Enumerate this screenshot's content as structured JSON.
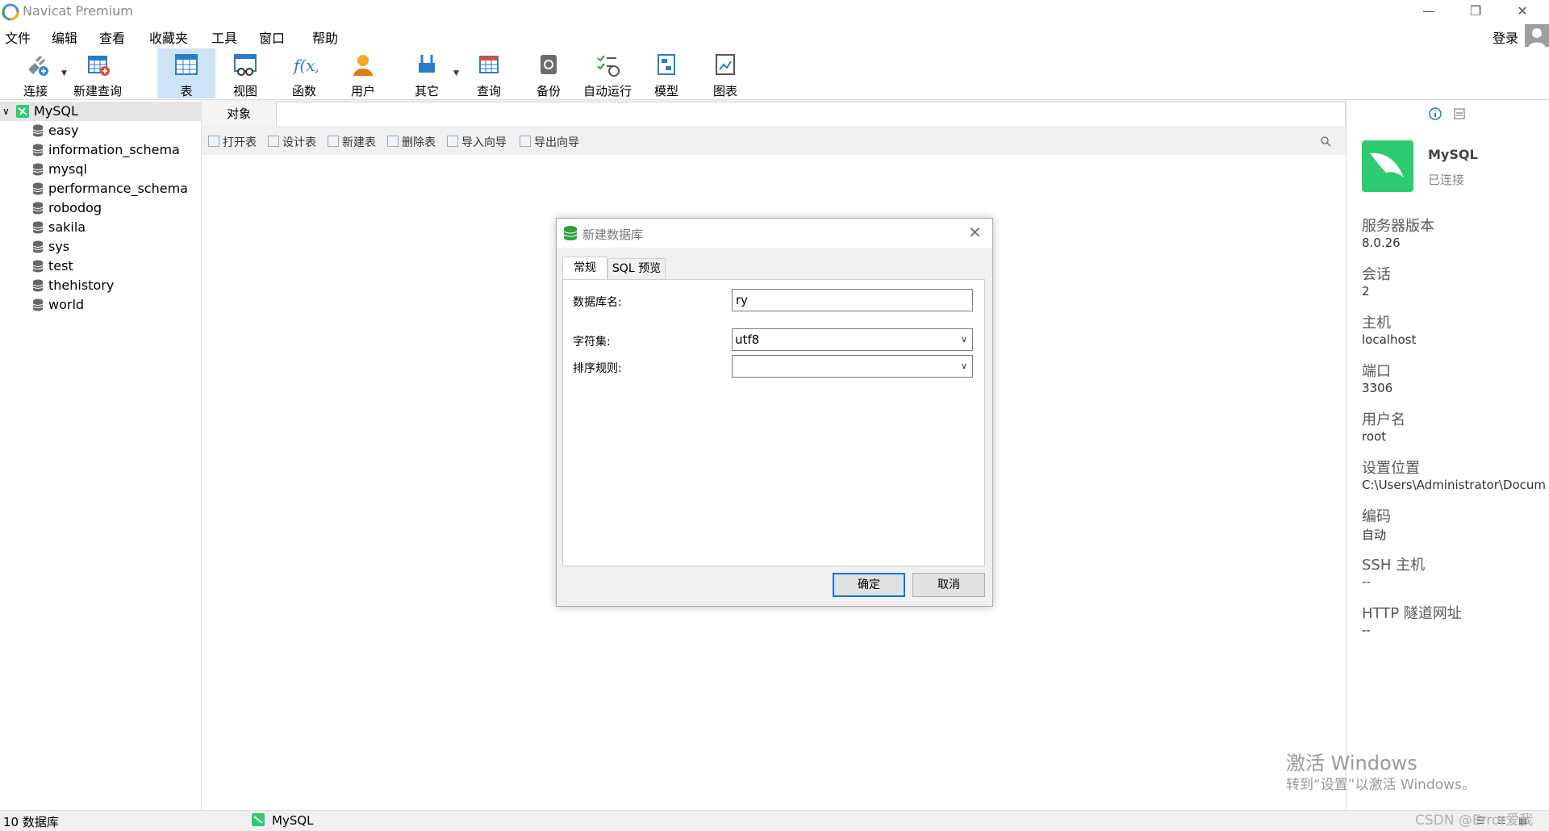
{
  "window": {
    "title": "Navicat Premium"
  },
  "menu": [
    "文件",
    "编辑",
    "查看",
    "收藏夹",
    "工具",
    "窗口",
    "帮助"
  ],
  "account": {
    "login_label": "登录"
  },
  "toolbar": {
    "connect": "连接",
    "new_query": "新建查询",
    "table": "表",
    "view": "视图",
    "function": "函数",
    "user": "用户",
    "other": "其它",
    "query": "查询",
    "backup": "备份",
    "auto_run": "自动运行",
    "model": "模型",
    "chart": "图表"
  },
  "tree": {
    "root": "MySQL",
    "databases": [
      "easy",
      "information_schema",
      "mysql",
      "performance_schema",
      "robodog",
      "sakila",
      "sys",
      "test",
      "thehistory",
      "world"
    ]
  },
  "objects_tab": {
    "label": "对象"
  },
  "object_toolbar": {
    "open_table": "打开表",
    "design_table": "设计表",
    "new_table": "新建表",
    "delete_table": "删除表",
    "import_wizard": "导入向导",
    "export_wizard": "导出向导"
  },
  "dialog": {
    "title": "新建数据库",
    "tabs": [
      "常规",
      "SQL 预览"
    ],
    "db_name_label": "数据库名:",
    "db_name_value": "ry",
    "charset_label": "字符集:",
    "charset_value": "utf8",
    "collation_label": "排序规则:",
    "collation_value": "",
    "ok": "确定",
    "cancel": "取消"
  },
  "info": {
    "connection_name": "MySQL",
    "status": "已连接",
    "fields": [
      {
        "label": "服务器版本",
        "value": "8.0.26"
      },
      {
        "label": "会话",
        "value": "2"
      },
      {
        "label": "主机",
        "value": "localhost"
      },
      {
        "label": "端口",
        "value": "3306"
      },
      {
        "label": "用户名",
        "value": "root"
      },
      {
        "label": "设置位置",
        "value": "C:\\Users\\Administrator\\Docum"
      },
      {
        "label": "编码",
        "value": "自动"
      },
      {
        "label": "SSH 主机",
        "value": "--"
      },
      {
        "label": "HTTP 隧道网址",
        "value": "--"
      }
    ]
  },
  "status": {
    "db_count": "10 数据库",
    "connection": "MySQL"
  },
  "watermark": {
    "line1": "激活 Windows",
    "line2": "转到“设置”以激活 Windows。",
    "credit": "CSDN @Error爱我"
  },
  "colors": {
    "accent": "#0078d7",
    "mysql_green": "#2ecc71",
    "toolbar_active": "#cde4f7"
  }
}
